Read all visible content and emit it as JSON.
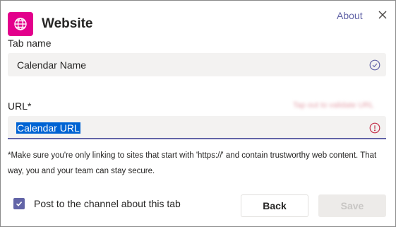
{
  "header": {
    "title": "Website",
    "about_label": "About",
    "app_icon": "globe-icon",
    "app_icon_color": "#e3008c",
    "close_icon": "close-icon"
  },
  "form": {
    "tab_name": {
      "label": "Tab name",
      "value": "Calendar Name",
      "status_icon": "check-circle-icon"
    },
    "url": {
      "label": "URL*",
      "value": "Calendar URL",
      "status_icon": "error-circle-icon",
      "error_text": "Tap out to validate URL"
    },
    "note": "*Make sure you're only linking to sites that start with 'https://' and contain trustworthy web content. That way, you and your team can stay secure."
  },
  "footer": {
    "post_checkbox": {
      "label": "Post to the channel about this tab",
      "checked": true
    },
    "back_label": "Back",
    "save_label": "Save",
    "save_enabled": false
  },
  "colors": {
    "accent": "#6264a7",
    "error": "#c4314b",
    "selection": "#0063d3"
  }
}
